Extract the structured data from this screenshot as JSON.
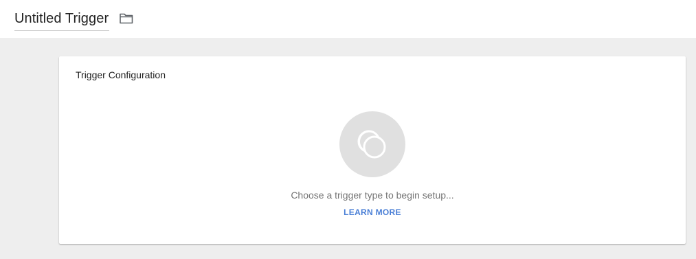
{
  "header": {
    "title": "Untitled Trigger",
    "folder_icon": "folder-icon"
  },
  "card": {
    "title": "Trigger Configuration",
    "trigger_icon": "trigger-type-placeholder-icon",
    "prompt": "Choose a trigger type to begin setup...",
    "learn_more_label": "LEARN MORE"
  },
  "colors": {
    "page_background": "#eeeeee",
    "card_background": "#ffffff",
    "link": "#4a7fd6",
    "circle": "#e0e0e0",
    "muted_text": "#757575"
  }
}
